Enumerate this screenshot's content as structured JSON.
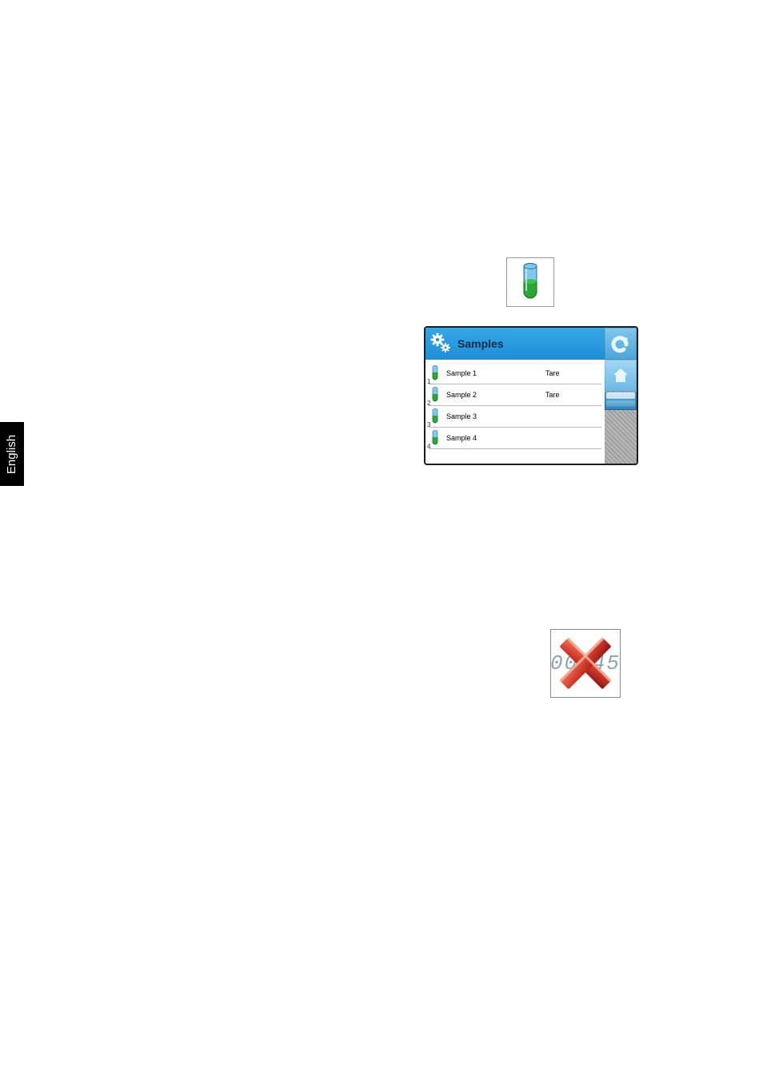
{
  "language_tab": "English",
  "tube_icon": {
    "name": "test-tube-icon"
  },
  "samples_dialog": {
    "title": "Samples",
    "header_icon": "double-gear-icon",
    "back_icon": "undo-arrow-icon",
    "home_icon": "home-icon",
    "rows": [
      {
        "num": "1",
        "name": "Sample 1",
        "tare": "Tare"
      },
      {
        "num": "2",
        "name": "Sample 2",
        "tare": "Tare"
      },
      {
        "num": "3",
        "name": "Sample 3",
        "tare": ""
      },
      {
        "num": "4",
        "name": "Sample 4",
        "tare": ""
      }
    ]
  },
  "cancel_box": {
    "lcd_text": "00:45",
    "icon": "red-x-icon"
  },
  "colors": {
    "header_blue": "#1d8fd8",
    "tube_blue": "#4aa3dc",
    "tube_green": "#2aa836",
    "x_red_dark": "#a31818",
    "x_red_light": "#e34a3a"
  }
}
